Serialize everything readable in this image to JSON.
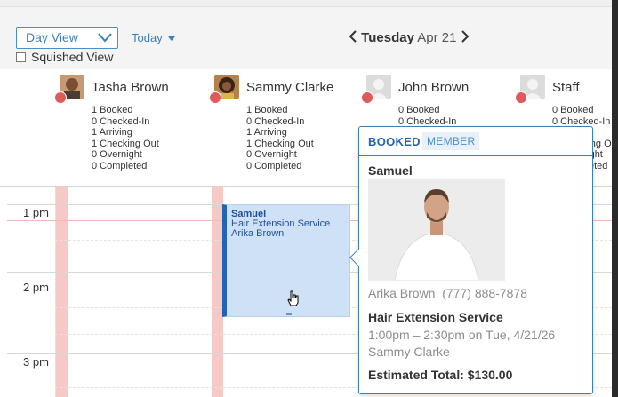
{
  "toolbar": {
    "view_select_value": "Day View",
    "today_label": "Today",
    "squished_label": "Squished View",
    "date_day": "Tuesday",
    "date_md": "Apr 21"
  },
  "staff": [
    {
      "name": "Tasha Brown",
      "stats": [
        "1 Booked",
        "0 Checked-In",
        "1 Arriving",
        "1 Checking Out",
        "0 Overnight",
        "0 Completed"
      ]
    },
    {
      "name": "Sammy Clarke",
      "stats": [
        "1 Booked",
        "0 Checked-In",
        "1 Arriving",
        "1 Checking Out",
        "0 Overnight",
        "0 Completed"
      ]
    },
    {
      "name": "John Brown",
      "stats": [
        "0 Booked",
        "0 Checked-In"
      ]
    },
    {
      "name": "Staff",
      "stats": [
        "0 Booked",
        "0 Checked-In",
        "0 Arriving",
        "0 Checking Out",
        "0 Overnight",
        "0 Completed"
      ]
    }
  ],
  "time_labels": [
    "1 pm",
    "2 pm",
    "3 pm"
  ],
  "appointment": {
    "client": "Samuel",
    "service": "Hair Extension Service",
    "staff": "Arika Brown"
  },
  "popover": {
    "status": "BOOKED",
    "badge": "MEMBER",
    "client": "Samuel",
    "contact_name": "Arika Brown",
    "contact_phone": "(777) 888-7878",
    "service": "Hair Extension Service",
    "time": "1:00pm – 2:30pm on Tue, 4/21/26",
    "staff": "Sammy Clarke",
    "total": "Estimated Total: $130.00"
  },
  "colors": {
    "accent": "#3a7fb8",
    "status_dot": "#e05a5a",
    "appt_bg": "#cfe1f7",
    "appt_border": "#2163b5",
    "unavailable": "#f6c9c7"
  },
  "icons": [
    "chevron-down-icon",
    "caret-down-icon",
    "chevron-left-icon",
    "chevron-right-icon",
    "hand-cursor-icon"
  ]
}
